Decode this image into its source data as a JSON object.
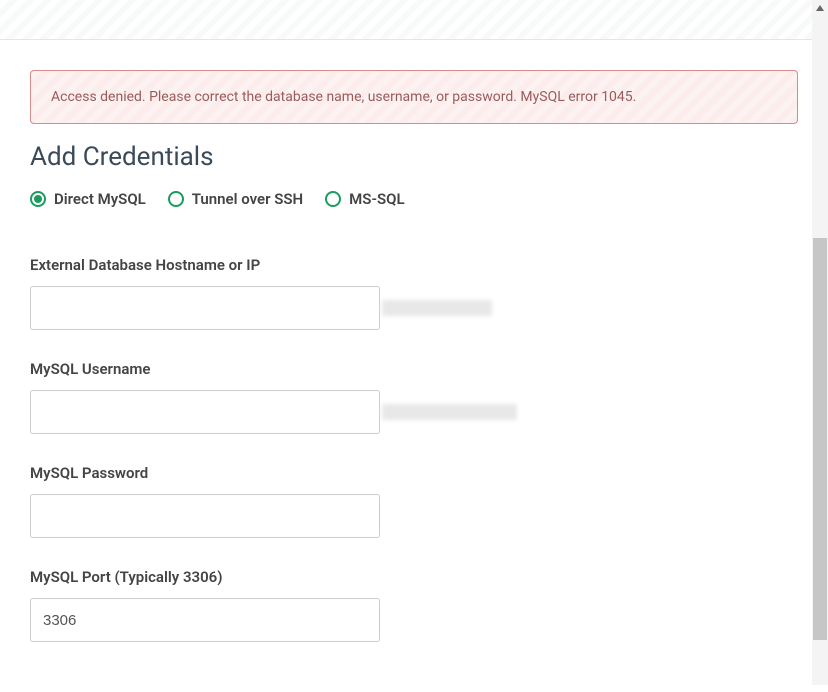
{
  "alert": {
    "message": "Access denied. Please correct the database name, username, or password. MySQL error 1045."
  },
  "heading": "Add Credentials",
  "connection_type": {
    "options": [
      {
        "label": "Direct MySQL",
        "selected": true
      },
      {
        "label": "Tunnel over SSH",
        "selected": false
      },
      {
        "label": "MS-SQL",
        "selected": false
      }
    ]
  },
  "fields": {
    "hostname": {
      "label": "External Database Hostname or IP",
      "value": ""
    },
    "username": {
      "label": "MySQL Username",
      "value": ""
    },
    "password": {
      "label": "MySQL Password",
      "value": ""
    },
    "port": {
      "label": "MySQL Port (Typically 3306)",
      "value": "3306"
    }
  }
}
